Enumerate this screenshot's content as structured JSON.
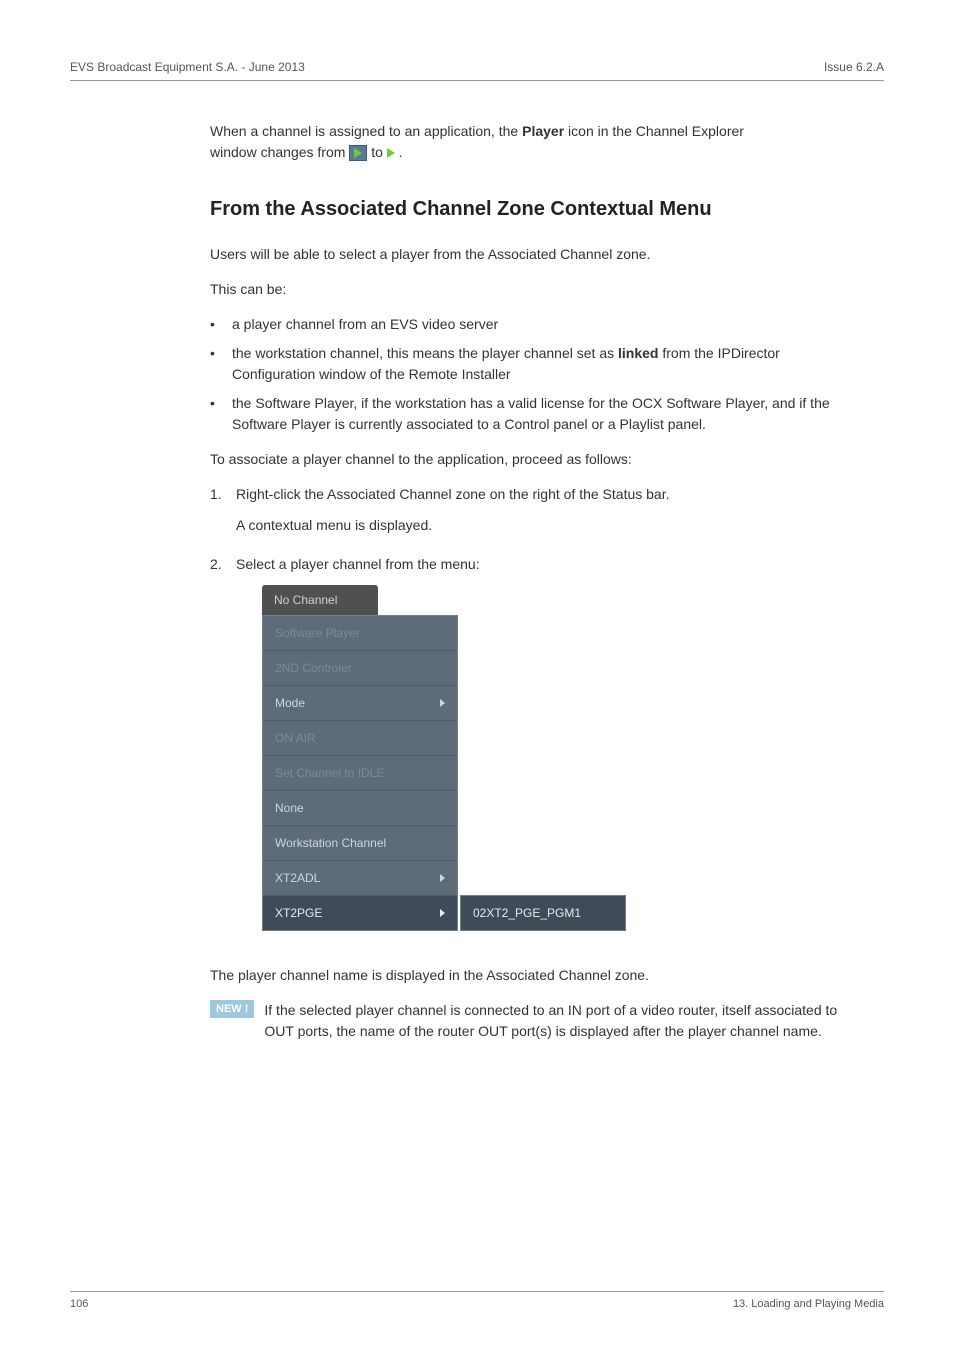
{
  "header": {
    "left": "EVS Broadcast Equipment S.A.  - June 2013",
    "right": "Issue 6.2.A"
  },
  "intro": {
    "line1_a": "When a channel is assigned to an application, the ",
    "line1_b": "Player",
    "line1_c": " icon in the Channel Explorer",
    "line2_a": "window changes from ",
    "line2_b": " to ",
    "line2_c": " ."
  },
  "section_title": "From the Associated Channel Zone Contextual Menu",
  "p1": "Users will be able to select a player from the Associated Channel zone.",
  "p2": "This can be:",
  "bullets": [
    {
      "text": "a player channel from an EVS video server"
    },
    {
      "textParts": [
        "the workstation channel, this means the player channel set as ",
        "linked",
        " from the IPDirector Configuration window of the Remote Installer"
      ]
    },
    {
      "text": "the Software Player, if the workstation has a valid license for the OCX Software Player, and if the Software Player is currently associated to a Control panel or a Playlist panel."
    }
  ],
  "p3": "To associate a player channel to the application, proceed as follows:",
  "steps": [
    {
      "num": "1.",
      "p1": "Right-click the Associated Channel zone on the right of the Status bar.",
      "p2": "A contextual menu is displayed."
    },
    {
      "num": "2.",
      "p1": "Select a player channel from the menu:"
    }
  ],
  "menu": {
    "header": "No Channel",
    "items": [
      {
        "label": "Software Player",
        "enabled": false,
        "arrow": false
      },
      {
        "label": "2ND Controler",
        "enabled": false,
        "arrow": false
      },
      {
        "label": "Mode",
        "enabled": true,
        "arrow": true
      },
      {
        "label": "ON AIR",
        "enabled": false,
        "arrow": false
      },
      {
        "label": "Set Channel to IDLE",
        "enabled": false,
        "arrow": false
      },
      {
        "label": "None",
        "enabled": true,
        "arrow": false
      },
      {
        "label": "Workstation Channel",
        "enabled": true,
        "arrow": false
      },
      {
        "label": "XT2ADL",
        "enabled": true,
        "arrow": true
      },
      {
        "label": "XT2PGE",
        "enabled": true,
        "arrow": true,
        "hover": true
      }
    ],
    "submenu_label": "02XT2_PGE_PGM1"
  },
  "p_after_menu": "The player channel name is displayed in the Associated Channel zone.",
  "new_badge": "NEW !",
  "new_text": "If the selected player channel is connected to an IN port of a video router, itself associated to OUT ports, the name of the router OUT port(s) is displayed after the player channel name.",
  "footer": {
    "left": "106",
    "right": "13. Loading and Playing Media"
  }
}
